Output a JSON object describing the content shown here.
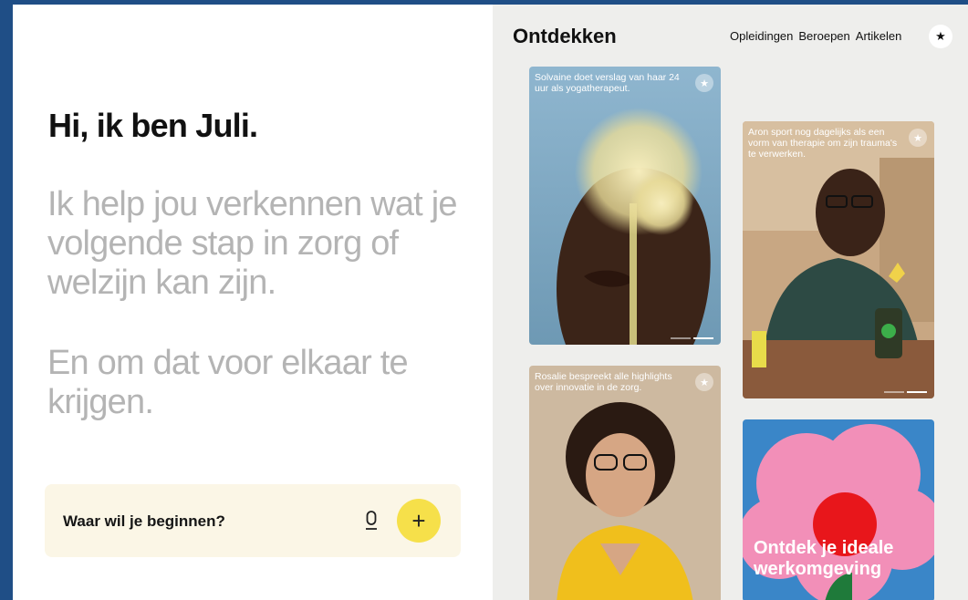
{
  "left": {
    "greeting": "Hi, ik ben Juli.",
    "intro": "Ik help jou verkennen wat je volgende stap in zorg of welzijn kan zijn.",
    "intro2": "En om dat voor elkaar te krijgen.",
    "prompt_label": "Waar wil je beginnen?",
    "add_symbol": "+"
  },
  "right": {
    "title": "Ontdekken",
    "nav": [
      "Opleidingen",
      "Beroepen",
      "Artikelen"
    ],
    "favorite_symbol": "★",
    "cards": [
      {
        "caption": "Solvaine doet verslag van haar 24 uur als yogatherapeut."
      },
      {
        "caption": "Aron sport nog dagelijks als een vorm van therapie om zijn trauma's te verwerken."
      },
      {
        "caption": "Rosalie bespreekt alle highlights over innovatie in de zorg."
      },
      {
        "caption": "Ontdek je ideale werkomgeving"
      }
    ]
  },
  "icons": {
    "mic": "microphone-icon",
    "add": "plus-icon",
    "star": "star-icon"
  },
  "colors": {
    "accent_yellow": "#f6e04a",
    "prompt_bg": "#fbf6e6",
    "frame_blue": "#1f4e86",
    "promo_blue": "#3a86c8",
    "promo_pink": "#f28fb8",
    "promo_red": "#e8161b"
  }
}
